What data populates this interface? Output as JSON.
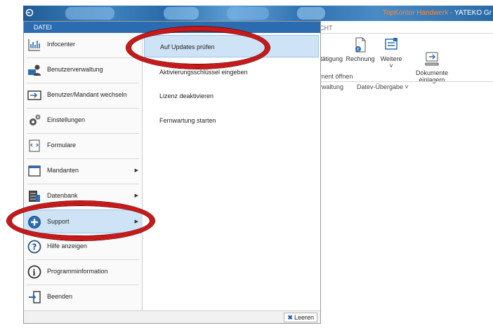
{
  "window": {
    "title_brand": "TopKontor Handwerk - ",
    "title_company": "YATEKO Gr"
  },
  "ribbon": {
    "tab_label": "CHT",
    "buttons": [
      {
        "label": "tätigung",
        "icon": "document-confirm-icon"
      },
      {
        "label": "Rechnung",
        "icon": "invoice-icon"
      },
      {
        "label": "Weitere",
        "icon": "more-documents-icon"
      },
      {
        "label": "Dokumente\neinlagern",
        "icon": "archive-documents-icon"
      }
    ],
    "weitere_chevron": "˅",
    "group_label": "ment öffnen",
    "sub_label_1": "rwaltung",
    "sub_label_2": "Datev-Übergabe ˅"
  },
  "file_menu": {
    "header": "DATEI",
    "items": [
      {
        "label": "Infocenter",
        "icon": "chart-icon",
        "submenu": false
      },
      {
        "label": "Benutzerverwaltung",
        "icon": "users-icon",
        "submenu": false
      },
      {
        "label": "Benutzer/Mandant wechseln",
        "icon": "switch-user-icon",
        "submenu": false
      },
      {
        "label": "Einstellungen",
        "icon": "gears-icon",
        "submenu": false
      },
      {
        "label": "Formulare",
        "icon": "form-icon",
        "submenu": false
      },
      {
        "label": "Mandanten",
        "icon": "window-icon",
        "submenu": true
      },
      {
        "label": "Datenbank",
        "icon": "database-icon",
        "submenu": true
      },
      {
        "label": "Support",
        "icon": "plus-circle-icon",
        "submenu": true
      },
      {
        "label": "Hilfe anzeigen",
        "icon": "help-icon",
        "submenu": false
      },
      {
        "label": "Programminformation",
        "icon": "info-icon",
        "submenu": false
      },
      {
        "label": "Beenden",
        "icon": "exit-icon",
        "submenu": false
      }
    ],
    "selected_item": "Support",
    "submenu_items": [
      {
        "label": "Auf Updates prüfen"
      },
      {
        "label": "Aktivierungsschlüssel eingeben"
      },
      {
        "label": "Lizenz deaktivieren"
      },
      {
        "label": "Fernwartung starten"
      }
    ],
    "clear_button": "Leeren",
    "submenu_arrow": "▶"
  },
  "colors": {
    "accent": "#2b6cb0",
    "selection": "#cfe3f7",
    "annotation_red": "#c81818"
  }
}
